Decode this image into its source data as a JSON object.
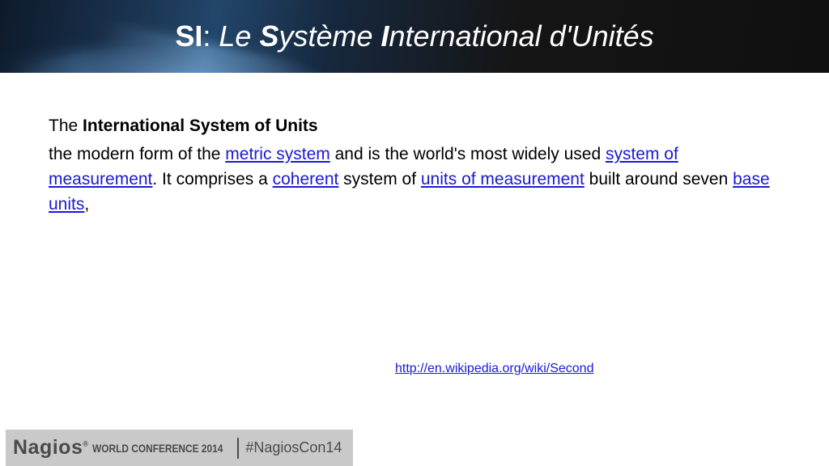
{
  "title": {
    "part1": "SI",
    "part2": ": ",
    "part3": "Le ",
    "part4": "S",
    "part5": "ystème ",
    "part6": "I",
    "part7": "nternational d'Unités"
  },
  "body": {
    "line1_prefix": "The ",
    "line1_bold": "International System of Units",
    "p2_text1": "the modern form of the ",
    "link_metric_system": "metric system",
    "p2_text2": " and is the world's most widely used ",
    "link_system_of_measurement": "system of measurement",
    "p2_text3": ". It comprises a ",
    "link_coherent": "coherent",
    "p2_text4": " system of ",
    "link_units_of_measurement": "units of measurement",
    "p2_text5": " built around seven ",
    "link_base_units": "base units",
    "p2_text6": ","
  },
  "source_url": "http://en.wikipedia.org/wiki/Second",
  "footer": {
    "brand": "Nagios",
    "reg": "®",
    "conference": "WORLD CONFERENCE 2014",
    "hashtag": "#NagiosCon14"
  },
  "colors": {
    "link": "#1a1ad6",
    "footer_bg": "#c9c9c9",
    "footer_text": "#4a4a4a"
  }
}
